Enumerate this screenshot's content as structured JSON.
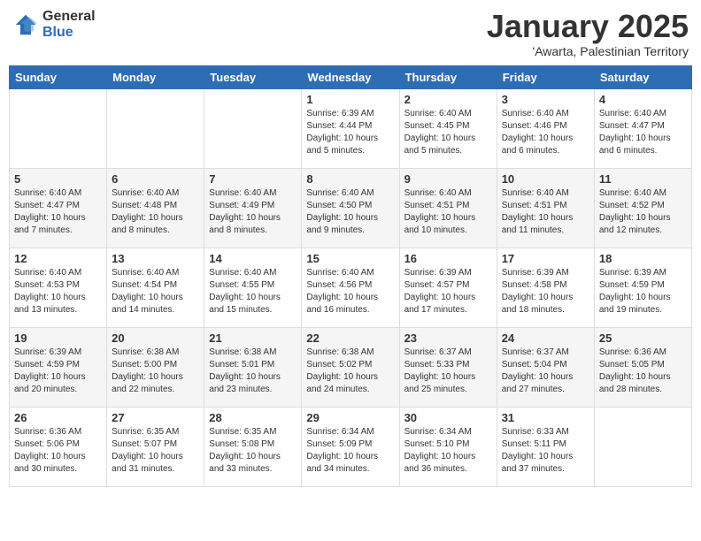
{
  "header": {
    "logo_general": "General",
    "logo_blue": "Blue",
    "title": "January 2025",
    "subtitle": "'Awarta, Palestinian Territory"
  },
  "days_of_week": [
    "Sunday",
    "Monday",
    "Tuesday",
    "Wednesday",
    "Thursday",
    "Friday",
    "Saturday"
  ],
  "weeks": [
    [
      {
        "num": "",
        "detail": ""
      },
      {
        "num": "",
        "detail": ""
      },
      {
        "num": "",
        "detail": ""
      },
      {
        "num": "1",
        "detail": "Sunrise: 6:39 AM\nSunset: 4:44 PM\nDaylight: 10 hours\nand 5 minutes."
      },
      {
        "num": "2",
        "detail": "Sunrise: 6:40 AM\nSunset: 4:45 PM\nDaylight: 10 hours\nand 5 minutes."
      },
      {
        "num": "3",
        "detail": "Sunrise: 6:40 AM\nSunset: 4:46 PM\nDaylight: 10 hours\nand 6 minutes."
      },
      {
        "num": "4",
        "detail": "Sunrise: 6:40 AM\nSunset: 4:47 PM\nDaylight: 10 hours\nand 6 minutes."
      }
    ],
    [
      {
        "num": "5",
        "detail": "Sunrise: 6:40 AM\nSunset: 4:47 PM\nDaylight: 10 hours\nand 7 minutes."
      },
      {
        "num": "6",
        "detail": "Sunrise: 6:40 AM\nSunset: 4:48 PM\nDaylight: 10 hours\nand 8 minutes."
      },
      {
        "num": "7",
        "detail": "Sunrise: 6:40 AM\nSunset: 4:49 PM\nDaylight: 10 hours\nand 8 minutes."
      },
      {
        "num": "8",
        "detail": "Sunrise: 6:40 AM\nSunset: 4:50 PM\nDaylight: 10 hours\nand 9 minutes."
      },
      {
        "num": "9",
        "detail": "Sunrise: 6:40 AM\nSunset: 4:51 PM\nDaylight: 10 hours\nand 10 minutes."
      },
      {
        "num": "10",
        "detail": "Sunrise: 6:40 AM\nSunset: 4:51 PM\nDaylight: 10 hours\nand 11 minutes."
      },
      {
        "num": "11",
        "detail": "Sunrise: 6:40 AM\nSunset: 4:52 PM\nDaylight: 10 hours\nand 12 minutes."
      }
    ],
    [
      {
        "num": "12",
        "detail": "Sunrise: 6:40 AM\nSunset: 4:53 PM\nDaylight: 10 hours\nand 13 minutes."
      },
      {
        "num": "13",
        "detail": "Sunrise: 6:40 AM\nSunset: 4:54 PM\nDaylight: 10 hours\nand 14 minutes."
      },
      {
        "num": "14",
        "detail": "Sunrise: 6:40 AM\nSunset: 4:55 PM\nDaylight: 10 hours\nand 15 minutes."
      },
      {
        "num": "15",
        "detail": "Sunrise: 6:40 AM\nSunset: 4:56 PM\nDaylight: 10 hours\nand 16 minutes."
      },
      {
        "num": "16",
        "detail": "Sunrise: 6:39 AM\nSunset: 4:57 PM\nDaylight: 10 hours\nand 17 minutes."
      },
      {
        "num": "17",
        "detail": "Sunrise: 6:39 AM\nSunset: 4:58 PM\nDaylight: 10 hours\nand 18 minutes."
      },
      {
        "num": "18",
        "detail": "Sunrise: 6:39 AM\nSunset: 4:59 PM\nDaylight: 10 hours\nand 19 minutes."
      }
    ],
    [
      {
        "num": "19",
        "detail": "Sunrise: 6:39 AM\nSunset: 4:59 PM\nDaylight: 10 hours\nand 20 minutes."
      },
      {
        "num": "20",
        "detail": "Sunrise: 6:38 AM\nSunset: 5:00 PM\nDaylight: 10 hours\nand 22 minutes."
      },
      {
        "num": "21",
        "detail": "Sunrise: 6:38 AM\nSunset: 5:01 PM\nDaylight: 10 hours\nand 23 minutes."
      },
      {
        "num": "22",
        "detail": "Sunrise: 6:38 AM\nSunset: 5:02 PM\nDaylight: 10 hours\nand 24 minutes."
      },
      {
        "num": "23",
        "detail": "Sunrise: 6:37 AM\nSunset: 5:33 PM\nDaylight: 10 hours\nand 25 minutes."
      },
      {
        "num": "24",
        "detail": "Sunrise: 6:37 AM\nSunset: 5:04 PM\nDaylight: 10 hours\nand 27 minutes."
      },
      {
        "num": "25",
        "detail": "Sunrise: 6:36 AM\nSunset: 5:05 PM\nDaylight: 10 hours\nand 28 minutes."
      }
    ],
    [
      {
        "num": "26",
        "detail": "Sunrise: 6:36 AM\nSunset: 5:06 PM\nDaylight: 10 hours\nand 30 minutes."
      },
      {
        "num": "27",
        "detail": "Sunrise: 6:35 AM\nSunset: 5:07 PM\nDaylight: 10 hours\nand 31 minutes."
      },
      {
        "num": "28",
        "detail": "Sunrise: 6:35 AM\nSunset: 5:08 PM\nDaylight: 10 hours\nand 33 minutes."
      },
      {
        "num": "29",
        "detail": "Sunrise: 6:34 AM\nSunset: 5:09 PM\nDaylight: 10 hours\nand 34 minutes."
      },
      {
        "num": "30",
        "detail": "Sunrise: 6:34 AM\nSunset: 5:10 PM\nDaylight: 10 hours\nand 36 minutes."
      },
      {
        "num": "31",
        "detail": "Sunrise: 6:33 AM\nSunset: 5:11 PM\nDaylight: 10 hours\nand 37 minutes."
      },
      {
        "num": "",
        "detail": ""
      }
    ]
  ]
}
